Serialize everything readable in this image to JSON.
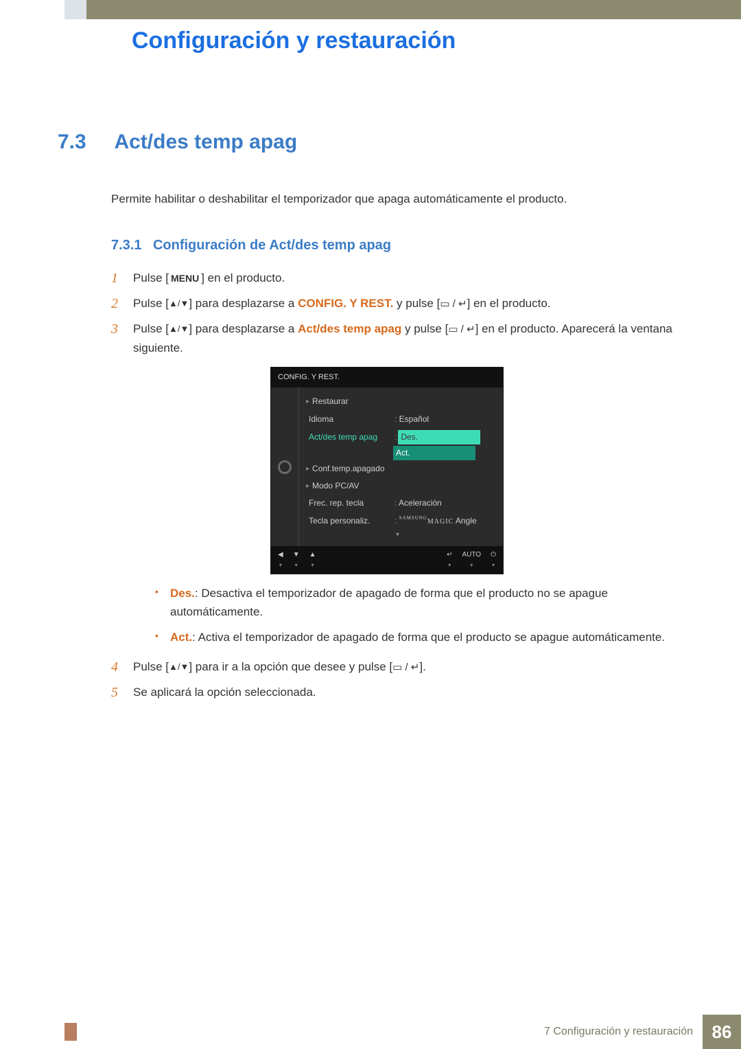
{
  "chapter_title": "Configuración y restauración",
  "section": {
    "number": "7.3",
    "title": "Act/des temp apag",
    "intro": "Permite habilitar o deshabilitar el temporizador que apaga automáticamente el producto."
  },
  "subsection": {
    "number": "7.3.1",
    "title": "Configuración de Act/des temp apag"
  },
  "step1": {
    "a": "Pulse [",
    "menu": "MENU",
    "b": "] en el producto."
  },
  "step2": {
    "a": "Pulse [",
    "ud": "▲/▼",
    "b": "] para desplazarse a ",
    "dest": "CONFIG. Y REST.",
    "c": " y pulse [",
    "enter": "▭ / ↵",
    "d": "] en el producto."
  },
  "step3": {
    "a": "Pulse [",
    "ud": "▲/▼",
    "b": "] para desplazarse a ",
    "dest": "Act/des temp apag",
    "c": " y pulse [",
    "enter": "▭ / ↵",
    "d": "] en el producto. Aparecerá la ventana siguiente."
  },
  "osd": {
    "header": "CONFIG. Y REST.",
    "rows": {
      "restaurar": "Restaurar",
      "idioma": "Idioma",
      "idioma_val": "Español",
      "actdes": "Act/des temp apag",
      "opt_des": "Des.",
      "opt_act": "Act.",
      "conf": "Conf.temp.apagado",
      "modo": "Modo PC/AV",
      "frec": "Frec. rep. tecla",
      "frec_val": "Aceleración",
      "tecla": "Tecla personaliz.",
      "tecla_val_pre": "SAMSUNG",
      "tecla_val_main": "MAGIC",
      "tecla_val_post": " Angle"
    },
    "footer": {
      "b1": "◀",
      "b2": "▼",
      "b3": "▲",
      "b4": "↵",
      "b5": "AUTO",
      "b6": "⏻",
      "sub": "▾"
    }
  },
  "bullets": {
    "des_label": "Des.",
    "des_text": ": Desactiva el temporizador de apagado de forma que el producto no se apague automáticamente.",
    "act_label": "Act.",
    "act_text": ": Activa el temporizador de apagado de forma que el producto se apague automáticamente."
  },
  "step4": {
    "a": "Pulse [",
    "ud": "▲/▼",
    "b": "] para ir a la opción que desee y pulse [",
    "enter": "▭ / ↵",
    "c": "]."
  },
  "step5": "Se aplicará la opción seleccionada.",
  "footer": {
    "text": "7 Configuración y restauración",
    "page": "86"
  }
}
